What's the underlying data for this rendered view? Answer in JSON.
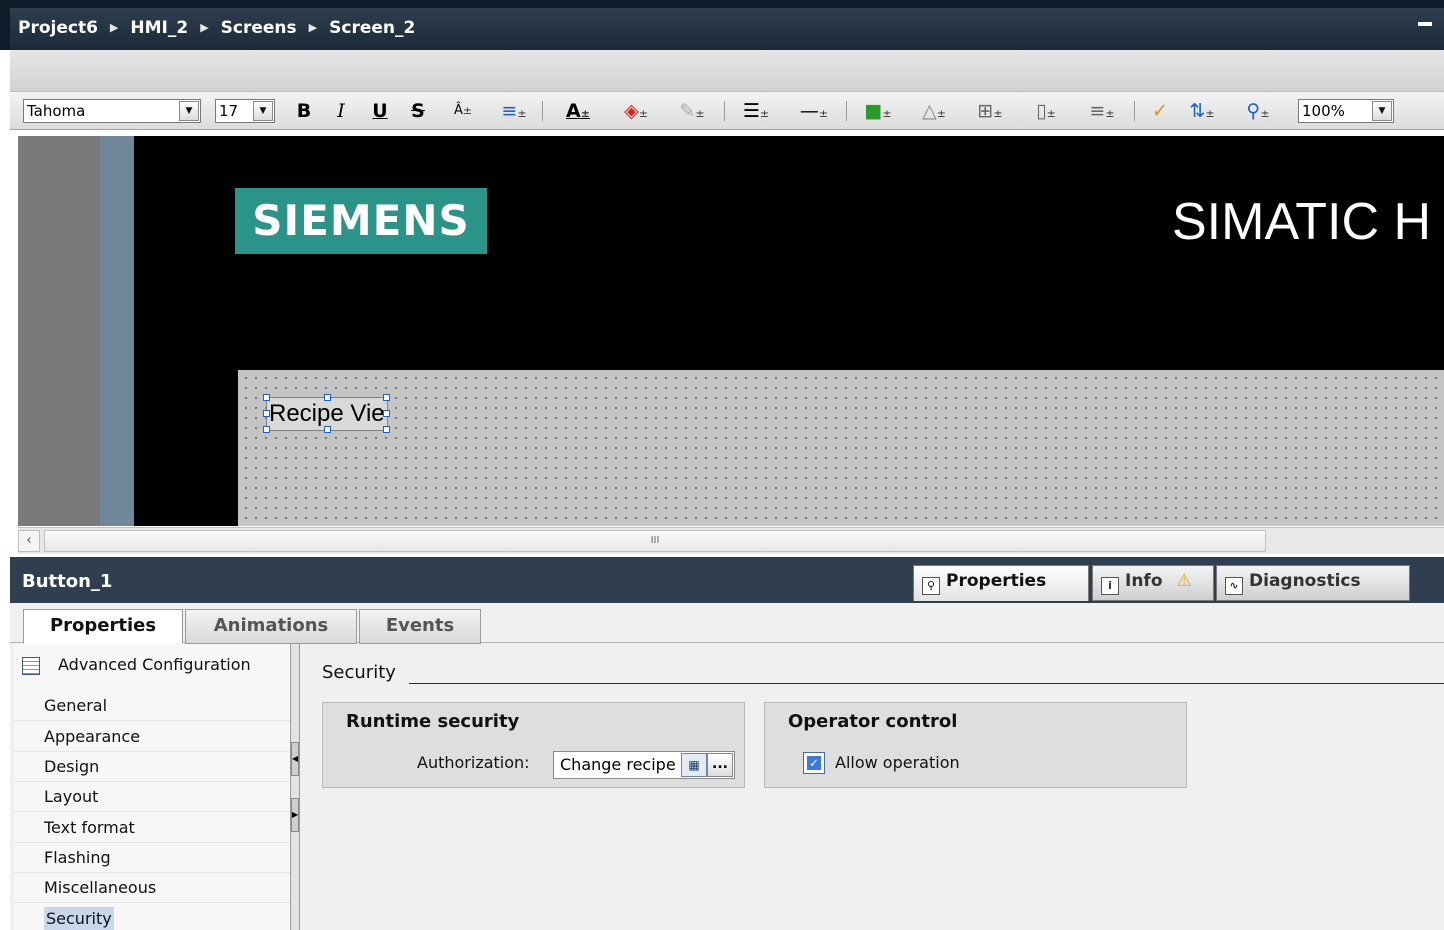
{
  "breadcrumb": {
    "items": [
      "Project6",
      "HMI_2",
      "Screens",
      "Screen_2"
    ]
  },
  "toolbar": {
    "font_family": "Tahoma",
    "font_size": "17",
    "bold": "B",
    "italic": "I",
    "underline": "U",
    "strike": "S",
    "zoom": "100%"
  },
  "screen": {
    "logo_text": "SIEMENS",
    "brand_text": "SIMATIC H",
    "button_text": "Recipe Vie",
    "logo_color": "#2a9489"
  },
  "scrollbar": {
    "thumb_grip": "III"
  },
  "inspector": {
    "object_name": "Button_1",
    "tabs": [
      {
        "label": "Properties",
        "icon": "properties-icon"
      },
      {
        "label": "Info",
        "icon": "info-icon"
      },
      {
        "label": "Diagnostics",
        "icon": "diagnostics-icon"
      }
    ],
    "subtabs": [
      "Properties",
      "Animations",
      "Events"
    ],
    "nav": {
      "advanced": "Advanced Configuration",
      "items": [
        "General",
        "Appearance",
        "Design",
        "Layout",
        "Text format",
        "Flashing",
        "Miscellaneous",
        "Security"
      ],
      "selected": "Security"
    },
    "section_title": "Security",
    "runtime_security": {
      "title": "Runtime security",
      "authorization_label": "Authorization:",
      "authorization_value": "Change recipe",
      "browse_label": "..."
    },
    "operator_control": {
      "title": "Operator control",
      "allow_label": "Allow operation",
      "allow_checked": true
    }
  }
}
